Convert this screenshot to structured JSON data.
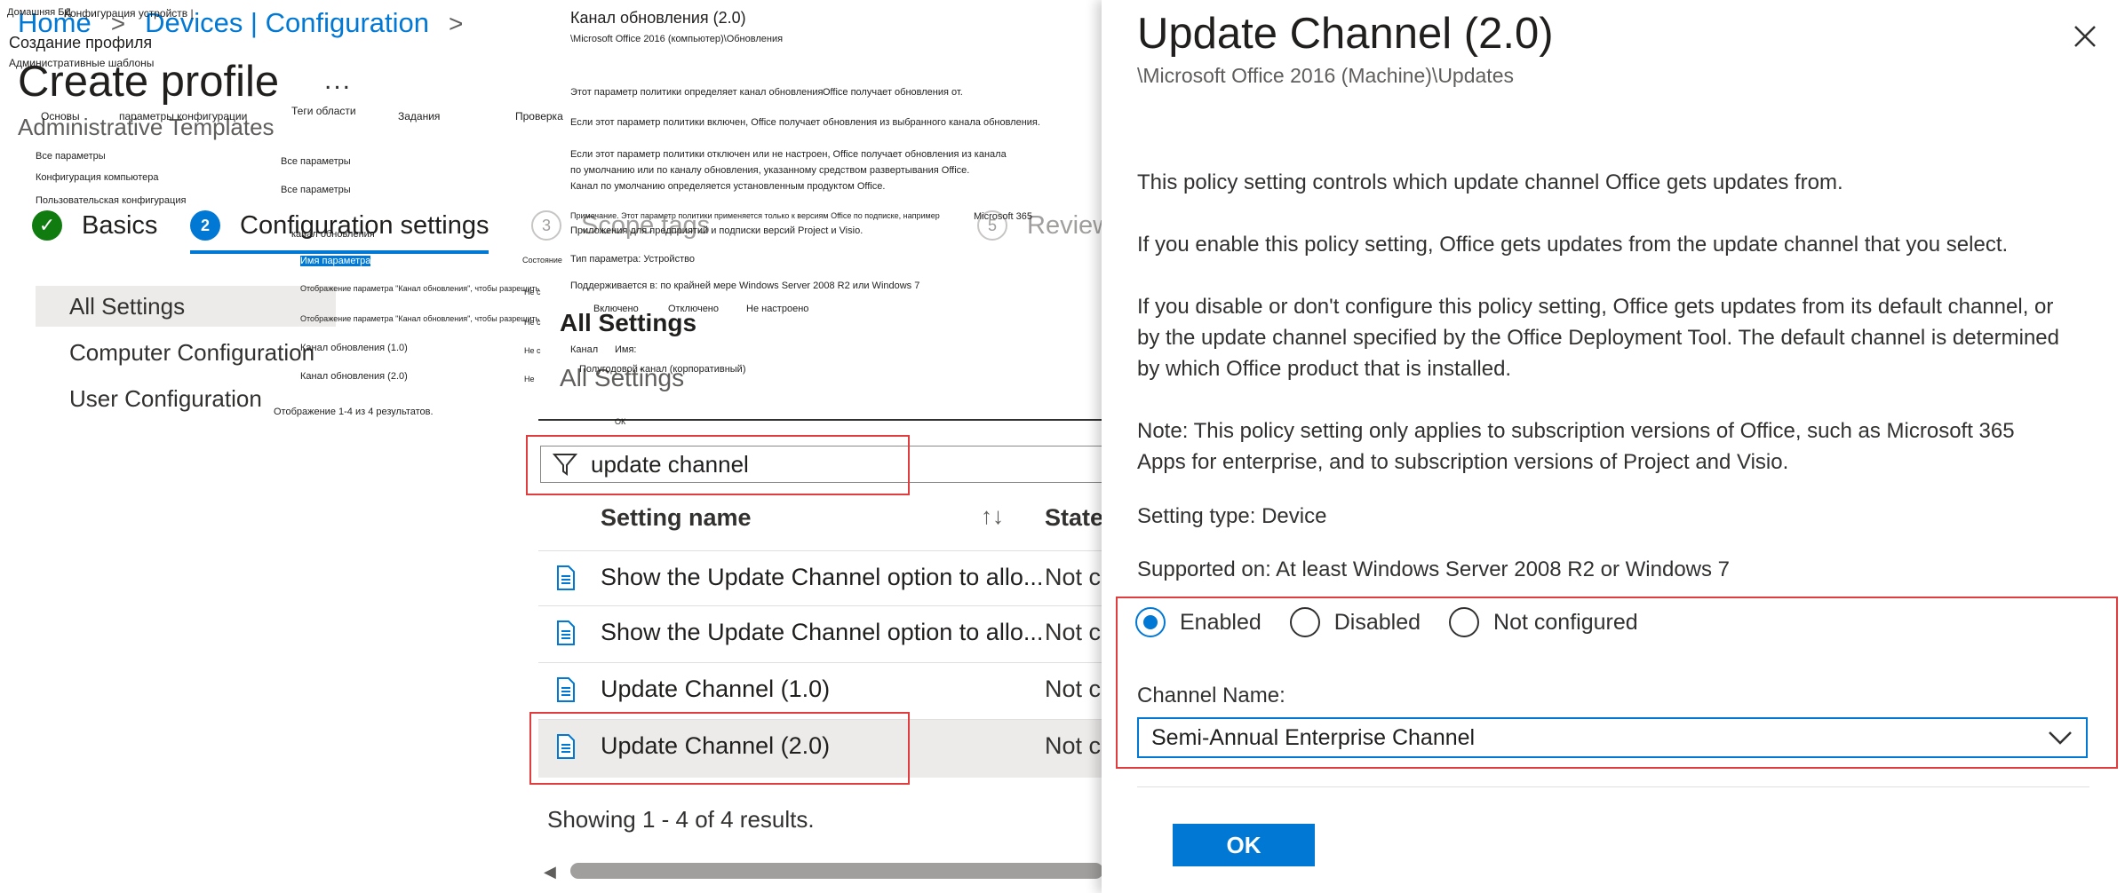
{
  "breadcrumb": {
    "home": "Home",
    "devices": "Devices | Configuration",
    "sep": ">"
  },
  "page": {
    "title": "Create profile",
    "more": "...",
    "subtitle": "Administrative Templates"
  },
  "wizard": {
    "steps": [
      {
        "num": "✓",
        "label": "Basics"
      },
      {
        "num": "2",
        "label": "Configuration settings"
      },
      {
        "num": "3",
        "label": "Scope tags"
      },
      {
        "num": "5",
        "label": "Review"
      }
    ]
  },
  "tree": {
    "items": [
      "All Settings",
      "Computer Configuration",
      "User Configuration"
    ]
  },
  "grid": {
    "title": "All Settings",
    "subtitle": "All Settings",
    "filter_value": "update channel",
    "col_name": "Setting name",
    "col_state": "State",
    "sort_icon": "↑↓",
    "rows": [
      {
        "name": "Show the Update Channel option to allo...",
        "state": "Not c"
      },
      {
        "name": "Show the Update Channel option to allo...",
        "state": "Not c"
      },
      {
        "name": "Update Channel (1.0)",
        "state": "Not c"
      },
      {
        "name": "Update Channel (2.0)",
        "state": "Not c"
      }
    ],
    "results": "Showing 1 - 4 of 4 results."
  },
  "ru_overlay": {
    "home": "Домашняя БД",
    "devices": "Конфигурация устройств |",
    "create": "Создание профиля",
    "admin_templates": "Административные шаблоны",
    "basics": "Основы",
    "config_params": "параметры конфигурации",
    "scope_tags": "Теги области",
    "assignments": "Задания",
    "review": "Проверка",
    "all_params_1": "Все параметры",
    "computer_config": "Конфигурация компьютера",
    "user_config": "Пользовательская конфигурация",
    "all_params_2": "Все параметры",
    "all_params_3": "Все параметры",
    "update_channel": "канал обновления",
    "param_name": "Имя параметра",
    "show_1": "Отображение параметра \"Канал обновления\", чтобы разрешить",
    "show_2": "Отображение параметра \"Канал обновления\", чтобы разрешить",
    "ch_10": "Канал обновления (1.0)",
    "ch_20": "Канал обновления (2.0)",
    "results": "Отображение 1-4 из 4 результатов.",
    "panel_title": "Канал обновления (2.0)",
    "panel_path": "\\Microsoft Office 2016 (компьютер)\\Обновления",
    "p1": "Этот параметр политики определяет канал обновления",
    "p1b": "Office получает обновления от.",
    "p2": "Если этот параметр политики включен, Office получает обновления из выбранного канала обновления.",
    "p3a": "Если этот параметр политики отключен или не настроен, Office получает обновления из канала",
    "p3b": "по умолчанию или по каналу обновления, указанному средством развертывания Office.",
    "p3c": "Канал по умолчанию определяется установленным продуктом Office.",
    "p4a": "Примечание. Этот параметр политики применяется только к версиям Office по подписке, например",
    "p4m365": "Microsoft 365",
    "p4b": "Приложения для предприятий и подписки версий Project и Visio.",
    "state": "Состояние",
    "setting_type": "Тип параметра: Устройство",
    "supported": "Поддерживается в: по крайней мере Windows Server 2008 R2 или Windows 7",
    "nc1": "Не с",
    "nc2": "Не с",
    "nc3": "Не с",
    "nc4": "Не",
    "enabled": "Включено",
    "disabled": "Отключено",
    "notconf": "Не настроено",
    "channel": "Канал",
    "name": "Имя:",
    "sae": "Полугодовой канал (корпоративный)",
    "ok": "ОК"
  },
  "panel": {
    "title": "Update Channel (2.0)",
    "path": "\\Microsoft Office 2016 (Machine)\\Updates",
    "desc1": "This policy setting controls which update channel Office gets updates from.",
    "desc2": "If you enable this policy setting, Office gets updates from the update channel that you select.",
    "desc3": "If you disable or don't configure this policy setting, Office gets updates from its default channel, or by the update channel specified by the Office Deployment Tool. The default channel is determined by which Office product that is installed.",
    "desc4": "Note: This policy setting only applies to subscription versions of Office, such as Microsoft 365 Apps for enterprise, and to subscription versions of Project and Visio.",
    "setting_type": "Setting type: Device",
    "supported": "Supported on: At least Windows Server 2008 R2 or Windows 7",
    "radio": {
      "enabled": "Enabled",
      "disabled": "Disabled",
      "not_configured": "Not configured",
      "selected": "enabled"
    },
    "channel_label": "Channel Name:",
    "channel_value": "Semi-Annual Enterprise Channel",
    "ok": "OK"
  },
  "colors": {
    "accent": "#0078d4",
    "highlight_box": "#e03e3e",
    "success": "#107c10"
  }
}
